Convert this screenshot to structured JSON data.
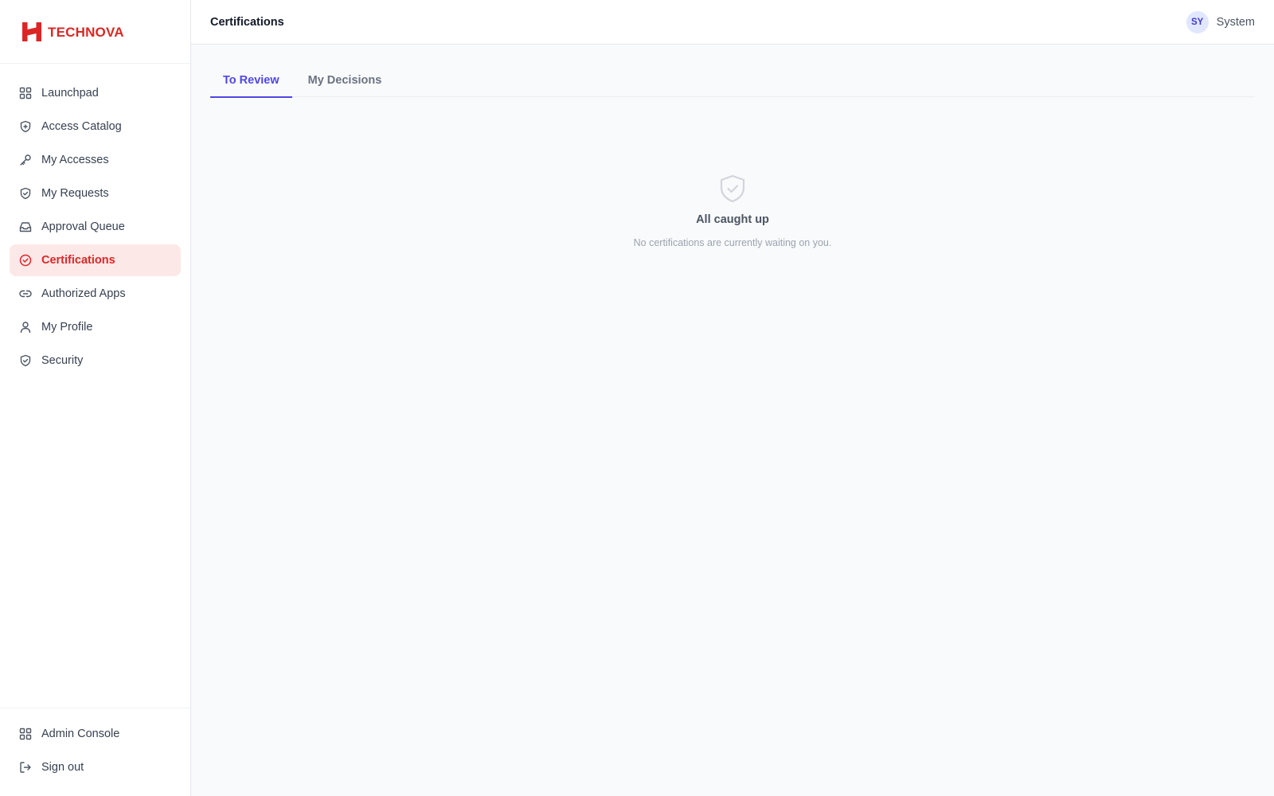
{
  "brand": {
    "name": "TECHNOVA",
    "color": "#dc2626"
  },
  "sidebar": {
    "items": [
      {
        "label": "Launchpad",
        "icon": "grid-icon"
      },
      {
        "label": "Access Catalog",
        "icon": "shield-plus-icon"
      },
      {
        "label": "My Accesses",
        "icon": "key-icon"
      },
      {
        "label": "My Requests",
        "icon": "shield-check-icon"
      },
      {
        "label": "Approval Queue",
        "icon": "inbox-icon"
      },
      {
        "label": "Certifications",
        "icon": "circle-check-icon",
        "active": true
      },
      {
        "label": "Authorized Apps",
        "icon": "link-icon"
      },
      {
        "label": "My Profile",
        "icon": "user-icon"
      },
      {
        "label": "Security",
        "icon": "shield-check-icon"
      }
    ],
    "bottom_items": [
      {
        "label": "Admin Console",
        "icon": "grid-icon"
      },
      {
        "label": "Sign out",
        "icon": "sign-out-icon"
      }
    ]
  },
  "header": {
    "title": "Certifications",
    "user": {
      "initials": "SY",
      "name": "System"
    }
  },
  "main": {
    "tabs": [
      {
        "label": "To Review",
        "active": true
      },
      {
        "label": "My Decisions",
        "active": false
      }
    ],
    "empty_state": {
      "icon": "shield-check-icon",
      "title": "All caught up",
      "message": "No certifications are currently waiting on you."
    }
  },
  "colors": {
    "accent": "#4f46e5",
    "active_nav_bg": "#fde8e8",
    "active_nav_text": "#dc2626"
  }
}
